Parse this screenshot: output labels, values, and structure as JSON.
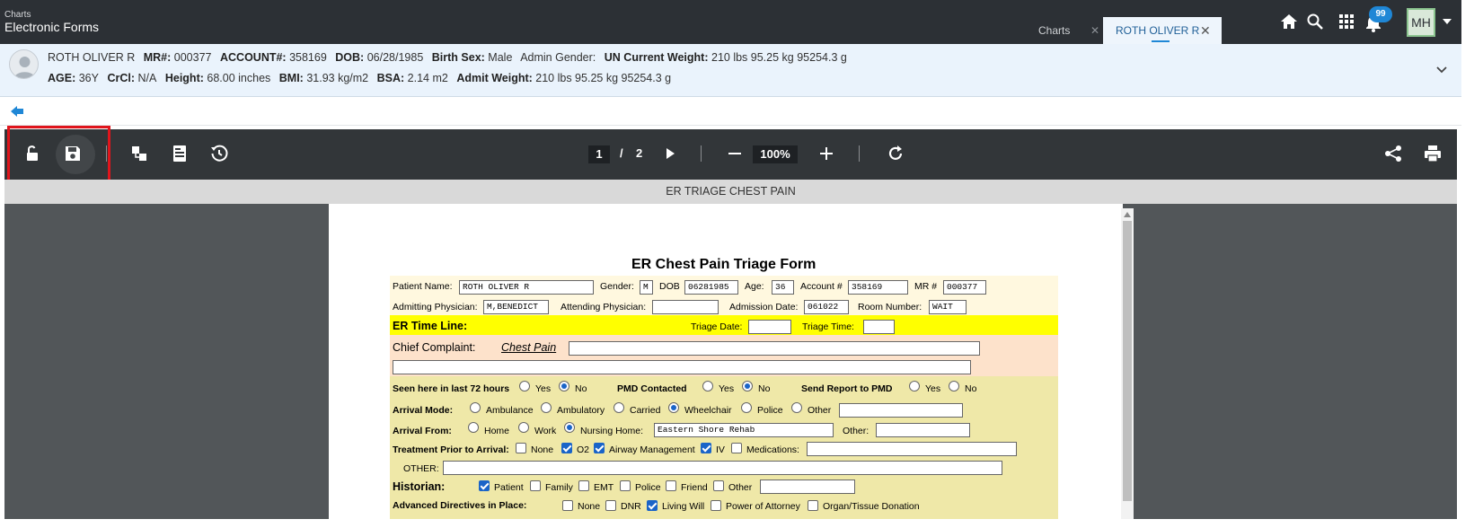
{
  "app": {
    "subtitle": "Charts",
    "title": "Electronic Forms"
  },
  "tabs": [
    {
      "label": "Charts",
      "close": "✕"
    },
    {
      "label": "ROTH OLIVER R",
      "close": "✕"
    }
  ],
  "notifications": {
    "count": "99"
  },
  "user": {
    "initials": "MH"
  },
  "patient": {
    "name": "ROTH OLIVER R",
    "mr_label": "MR#:",
    "mr": "000377",
    "account_label": "ACCOUNT#:",
    "account": "358169",
    "dob_label": "DOB:",
    "dob": "06/28/1985",
    "birth_sex_label": "Birth Sex:",
    "birth_sex": "Male",
    "admin_gender_label": "Admin Gender:",
    "admin_gender": "UN",
    "current_weight_label": "Current Weight:",
    "current_weight": "210 lbs 95.25 kg 95254.3 g",
    "age_label": "AGE:",
    "age": "36Y",
    "crcl_label": "CrCl:",
    "crcl": "N/A",
    "height_label": "Height:",
    "height": "68.00 inches",
    "bmi_label": "BMI:",
    "bmi": "31.93 kg/m2",
    "bsa_label": "BSA:",
    "bsa": "2.14 m2",
    "admit_weight_label": "Admit Weight:",
    "admit_weight": "210 lbs 95.25 kg 95254.3 g"
  },
  "viewer": {
    "page_current": "1",
    "page_sep": "/",
    "page_total": "2",
    "zoom": "100%",
    "doc_title": "ER TRIAGE CHEST PAIN"
  },
  "icons": [
    "unlock-icon",
    "save-icon",
    "layout-icon",
    "form-icon",
    "history-icon",
    "play-icon",
    "minus-icon",
    "plus-icon",
    "refresh-icon",
    "share-icon",
    "print-icon",
    "home-icon",
    "search-icon",
    "apps-icon",
    "bell-icon"
  ],
  "colors": {
    "highlight": "#e0151c",
    "accent": "#1f87d6",
    "timeline": "#ffff00"
  },
  "form": {
    "title": "ER Chest Pain Triage Form",
    "patient_name_label": "Patient Name:",
    "patient_name": "ROTH OLIVER R",
    "gender_label": "Gender:",
    "gender": "M",
    "dob_label": "DOB",
    "dob": "06281985",
    "age_label": "Age:",
    "age": "36",
    "account_label": "Account #",
    "account": "358169",
    "mr_label": "MR #",
    "mr": "000377",
    "admitting_label": "Admitting Physician:",
    "admitting": "M,BENEDICT",
    "attending_label": "Attending Physician:",
    "attending": "",
    "admission_date_label": "Admission Date:",
    "admission_date": "061022",
    "room_label": "Room Number:",
    "room": "WAIT",
    "timeline_label": "ER Time Line:",
    "triage_date_label": "Triage Date:",
    "triage_date": "",
    "triage_time_label": "Triage Time:",
    "triage_time": "",
    "complaint_label": "Chief Complaint:",
    "complaint": "Chest Pain",
    "seen72_label": "Seen here in last 72 hours",
    "pmd_label": "PMD Contacted",
    "report_label": "Send Report to PMD",
    "yes": "Yes",
    "no": "No",
    "arrival_mode_label": "Arrival Mode:",
    "arrival_modes": [
      "Ambulance",
      "Ambulatory",
      "Carried",
      "Wheelchair",
      "Police",
      "Other"
    ],
    "arrival_mode_selected": "Wheelchair",
    "arrival_from_label": "Arrival From:",
    "arrival_from": [
      "Home",
      "Work",
      "Nursing Home:"
    ],
    "arrival_from_selected": "Nursing Home:",
    "nursing_home": "Eastern Shore Rehab",
    "other_label": "Other:",
    "treatment_label": "Treatment Prior to Arrival:",
    "treatments": [
      "None",
      "O2",
      "Airway Management",
      "IV",
      "Medications:"
    ],
    "treatments_checked": [
      "O2",
      "Airway Management",
      "IV"
    ],
    "other_caps_label": "OTHER:",
    "historian_label": "Historian:",
    "historians": [
      "Patient",
      "Family",
      "EMT",
      "Police",
      "Friend",
      "Other"
    ],
    "historians_checked": [
      "Patient"
    ],
    "directives_label": "Advanced Directives in Place:",
    "directives": [
      "None",
      "DNR",
      "Living Will",
      "Power of Attorney",
      "Organ/Tissue Donation"
    ],
    "directives_checked": [
      "Living Will"
    ]
  }
}
